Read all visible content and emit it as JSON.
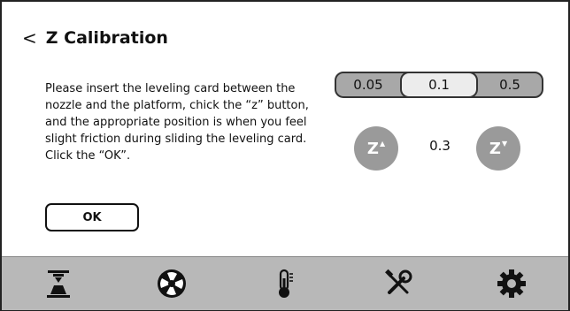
{
  "header": {
    "back_symbol": "<",
    "title": "Z Calibration"
  },
  "instructions": "Please insert the leveling card between the nozzle and the platform, chick the “z” button, and the appropriate position is when you feel slight friction during sliding the leveling card. Click the “OK”.",
  "ok_button": {
    "label": "OK"
  },
  "step_sizes": {
    "options": [
      "0.05",
      "0.1",
      "0.5"
    ],
    "selected": "0.1"
  },
  "z_control": {
    "up_label": "Z",
    "up_marker": "▲",
    "down_label": "Z",
    "down_marker": "▼",
    "current_value": "0.3"
  },
  "navbar": {
    "items": [
      {
        "icon": "print-platform-icon"
      },
      {
        "icon": "fan-icon"
      },
      {
        "icon": "thermometer-icon"
      },
      {
        "icon": "tools-icon"
      },
      {
        "icon": "gear-icon"
      }
    ]
  },
  "colors": {
    "button_gray": "#9a9a9a",
    "navbar_bg": "#b8b8b8",
    "selected_step_bg": "#ececec"
  }
}
